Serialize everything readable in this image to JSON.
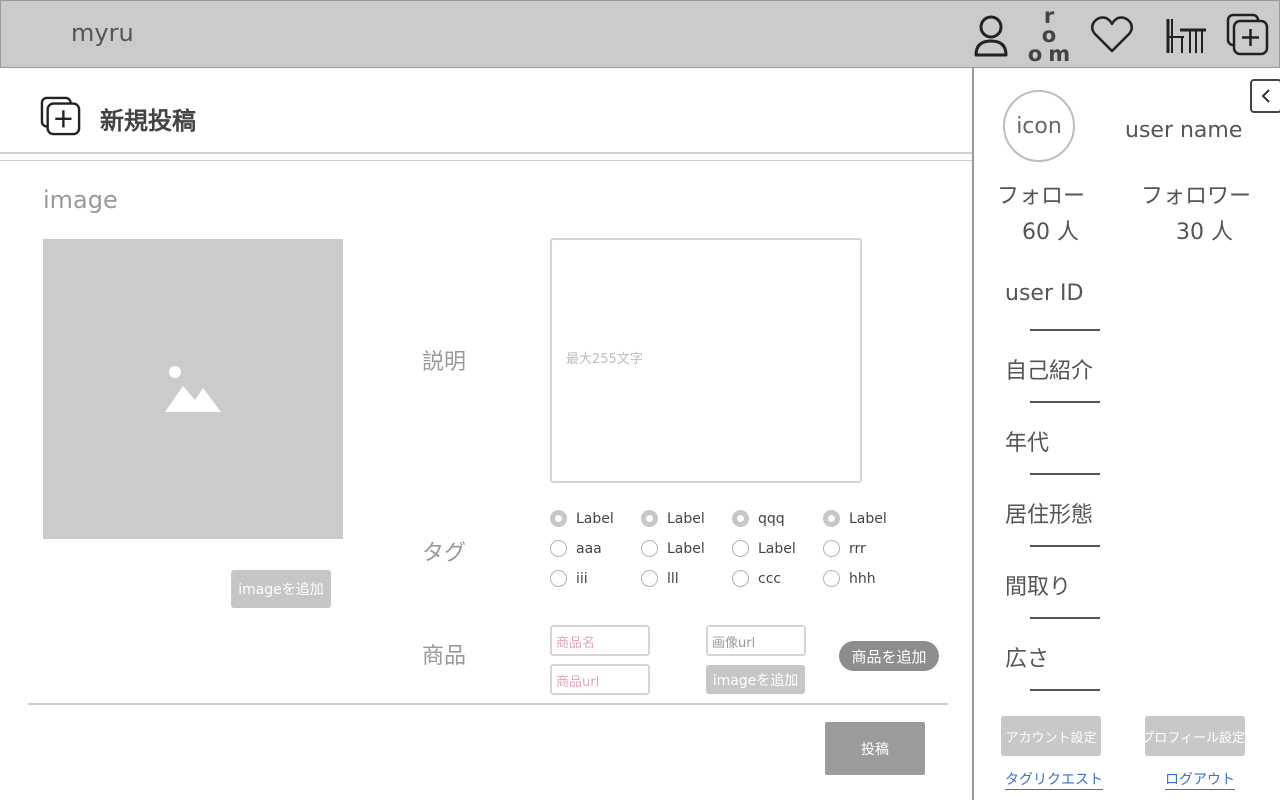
{
  "header": {
    "brand": "myru",
    "room_label": "ro\nom",
    "icons": [
      "user-icon",
      "room-icon",
      "heart-icon",
      "furniture-icon",
      "new-post-icon"
    ]
  },
  "page": {
    "title": "新規投稿"
  },
  "image_section": {
    "label": "image",
    "add_button": "imageを追加"
  },
  "form": {
    "description": {
      "label": "説明",
      "placeholder": "最大255文字"
    },
    "tags": {
      "label": "タグ",
      "rows": [
        [
          {
            "label": "Label",
            "checked": true
          },
          {
            "label": "Label",
            "checked": true
          },
          {
            "label": "qqq",
            "checked": true
          },
          {
            "label": "Label",
            "checked": true
          }
        ],
        [
          {
            "label": "aaa",
            "checked": false
          },
          {
            "label": "Label",
            "checked": false
          },
          {
            "label": "Label",
            "checked": false
          },
          {
            "label": "rrr",
            "checked": false
          }
        ],
        [
          {
            "label": "iii",
            "checked": false
          },
          {
            "label": "lll",
            "checked": false
          },
          {
            "label": "ccc",
            "checked": false
          },
          {
            "label": "hhh",
            "checked": false
          }
        ]
      ]
    },
    "products": {
      "label": "商品",
      "name_placeholder": "商品名",
      "url_placeholder": "商品url",
      "image_url_placeholder": "画像url",
      "add_image_button": "imageを追加",
      "add_product_button": "商品を追加"
    },
    "submit_button": "投稿"
  },
  "sidebar": {
    "avatar_text": "icon",
    "user_name": "user name",
    "follow_label": "フォロー",
    "follow_count": "60 人",
    "follower_label": "フォロワー",
    "follower_count": "30 人",
    "profile_fields": [
      {
        "label": "user ID"
      },
      {
        "label": "自己紹介"
      },
      {
        "label": "年代"
      },
      {
        "label": "居住形態"
      },
      {
        "label": "間取り"
      },
      {
        "label": "広さ"
      }
    ],
    "account_settings_button": "アカウント設定",
    "profile_settings_button": "プロフィール設定",
    "tag_request_link": "タグリクエスト",
    "logout_link": "ログアウト"
  },
  "colors": {
    "header_bg": "#cbcbcb",
    "link": "#3b6fcf",
    "placeholder_pink": "#e3a6b6"
  }
}
